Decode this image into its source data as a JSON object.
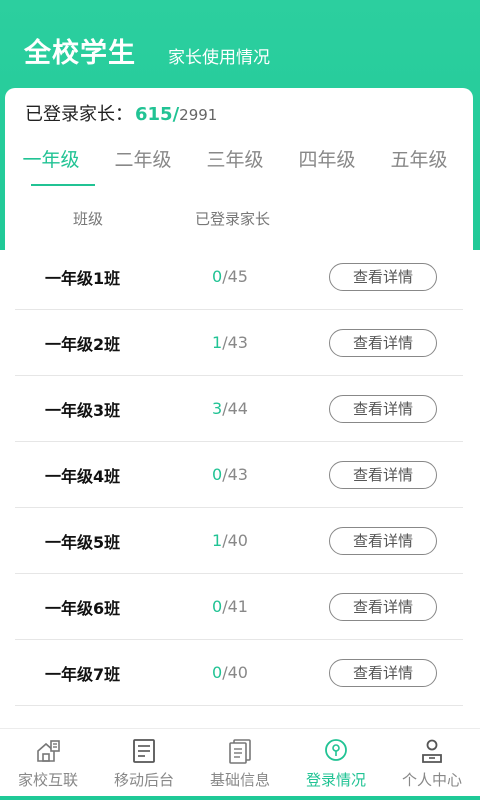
{
  "header": {
    "title": "全校学生",
    "subtitle": "家长使用情况"
  },
  "summary": {
    "label": "已登录家长：",
    "logged": "615",
    "slash": "/",
    "total": "2991"
  },
  "tabs": [
    {
      "label": "一年级",
      "active": true
    },
    {
      "label": "二年级",
      "active": false
    },
    {
      "label": "三年级",
      "active": false
    },
    {
      "label": "四年级",
      "active": false
    },
    {
      "label": "五年级",
      "active": false
    }
  ],
  "table": {
    "headers": [
      "班级",
      "已登录家长"
    ],
    "button_label": "查看详情",
    "rows": [
      {
        "class": "一年级1班",
        "logged": "0",
        "total": "45"
      },
      {
        "class": "一年级2班",
        "logged": "1",
        "total": "43"
      },
      {
        "class": "一年级3班",
        "logged": "3",
        "total": "44"
      },
      {
        "class": "一年级4班",
        "logged": "0",
        "total": "43"
      },
      {
        "class": "一年级5班",
        "logged": "1",
        "total": "40"
      },
      {
        "class": "一年级6班",
        "logged": "0",
        "total": "41"
      },
      {
        "class": "一年级7班",
        "logged": "0",
        "total": "40"
      }
    ]
  },
  "nav": [
    {
      "label": "家校互联",
      "icon": "home-link-icon",
      "active": false
    },
    {
      "label": "移动后台",
      "icon": "document-list-icon",
      "active": false
    },
    {
      "label": "基础信息",
      "icon": "info-doc-icon",
      "active": false
    },
    {
      "label": "登录情况",
      "icon": "login-status-icon",
      "active": true
    },
    {
      "label": "个人中心",
      "icon": "user-icon",
      "active": false
    }
  ],
  "colors": {
    "accent": "#21c394",
    "header": "#20c997"
  }
}
